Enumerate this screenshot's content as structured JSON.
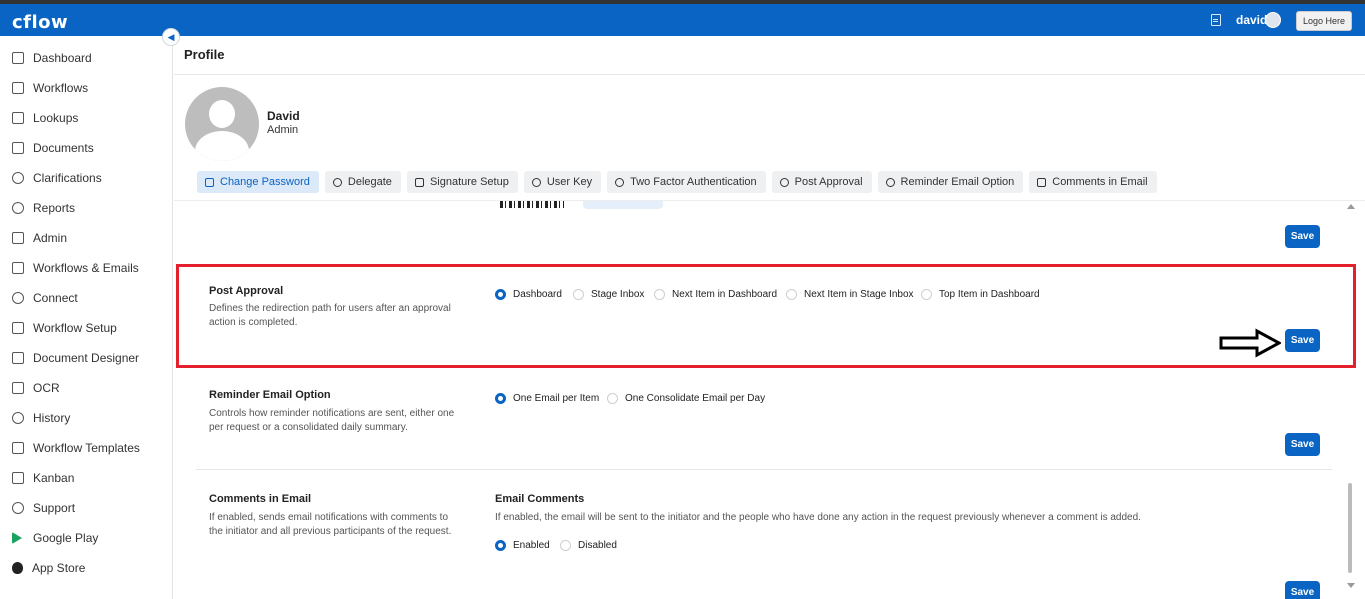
{
  "header": {
    "logo_text": "cflow",
    "username": "david",
    "logo_button": "Logo Here"
  },
  "sidebar": {
    "items": [
      {
        "label": "Dashboard",
        "icon": "dashboard-icon"
      },
      {
        "label": "Workflows",
        "icon": "workflows-icon"
      },
      {
        "label": "Lookups",
        "icon": "table-icon"
      },
      {
        "label": "Documents",
        "icon": "document-icon"
      },
      {
        "label": "Clarifications",
        "icon": "lightbulb-icon"
      },
      {
        "label": "Reports",
        "icon": "pie-chart-icon"
      },
      {
        "label": "Admin",
        "icon": "admin-icon"
      },
      {
        "label": "Workflows & Emails",
        "icon": "mail-icon"
      },
      {
        "label": "Connect",
        "icon": "connect-icon"
      },
      {
        "label": "Workflow Setup",
        "icon": "sliders-icon"
      },
      {
        "label": "Document Designer",
        "icon": "edit-icon"
      },
      {
        "label": "OCR",
        "icon": "scan-icon"
      },
      {
        "label": "History",
        "icon": "history-icon"
      },
      {
        "label": "Workflow Templates",
        "icon": "templates-icon"
      },
      {
        "label": "Kanban",
        "icon": "kanban-icon"
      },
      {
        "label": "Support",
        "icon": "support-icon"
      },
      {
        "label": "Google Play",
        "icon": "google-play-icon"
      },
      {
        "label": "App Store",
        "icon": "apple-icon"
      }
    ]
  },
  "page": {
    "title": "Profile",
    "user_name": "David",
    "user_role": "Admin"
  },
  "tabs": [
    {
      "label": "Change Password",
      "active": true
    },
    {
      "label": "Delegate"
    },
    {
      "label": "Signature Setup"
    },
    {
      "label": "User Key"
    },
    {
      "label": "Two Factor Authentication"
    },
    {
      "label": "Post Approval"
    },
    {
      "label": "Reminder Email Option"
    },
    {
      "label": "Comments in Email"
    }
  ],
  "save_label": "Save",
  "post_approval": {
    "title": "Post Approval",
    "description": "Defines the redirection path for users after an approval action is completed.",
    "options": [
      "Dashboard",
      "Stage Inbox",
      "Next Item in Dashboard",
      "Next Item in Stage Inbox",
      "Top Item in Dashboard"
    ],
    "selected": "Dashboard"
  },
  "reminder": {
    "title": "Reminder Email Option",
    "description": "Controls how reminder notifications are sent, either one per request or a consolidated daily summary.",
    "options": [
      "One Email per Item",
      "One Consolidate Email per Day"
    ],
    "selected": "One Email per Item"
  },
  "comments": {
    "title": "Comments in Email",
    "description": "If enabled, sends email notifications with comments to the initiator and all previous participants of the request.",
    "sub_title": "Email Comments",
    "sub_description": "If enabled, the email will be sent to the initiator and the people who have done any action in the request previously whenever a comment is added.",
    "options": [
      "Enabled",
      "Disabled"
    ],
    "selected": "Enabled"
  },
  "colors": {
    "brand": "#0a64c3",
    "highlight": "#e3202b"
  }
}
